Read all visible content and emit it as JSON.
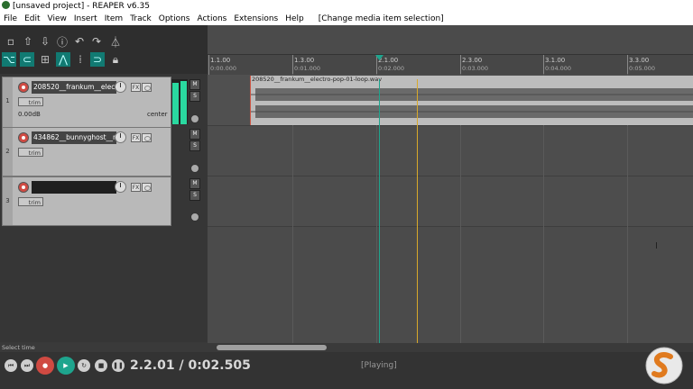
{
  "window": {
    "title": "[unsaved project] - REAPER v6.35"
  },
  "menu": {
    "items": [
      "File",
      "Edit",
      "View",
      "Insert",
      "Item",
      "Track",
      "Options",
      "Actions",
      "Extensions",
      "Help"
    ],
    "message": "[Change media item selection]"
  },
  "tracks": [
    {
      "number": "1",
      "name": "208520__frankum__elec",
      "trim": "trim",
      "volume": "0.00dB",
      "pan": "center"
    },
    {
      "number": "2",
      "name": "434862__bunnyghost__r",
      "trim": "trim"
    },
    {
      "number": "3",
      "name": "",
      "trim": "trim"
    }
  ],
  "track_buttons": {
    "fx": "FX",
    "mute": "M",
    "solo": "S"
  },
  "ruler": [
    {
      "bar": "1.1.00",
      "time": "0:00.000"
    },
    {
      "bar": "1.3.00",
      "time": "0:01.000"
    },
    {
      "bar": "2.1.00",
      "time": "0:02.000"
    },
    {
      "bar": "2.3.00",
      "time": "0:03.000"
    },
    {
      "bar": "3.1.00",
      "time": "0:04.000"
    },
    {
      "bar": "3.3.00",
      "time": "0:05.000"
    }
  ],
  "item": {
    "name": "208520__frankum__electro-pop-01-loop.wav"
  },
  "status": {
    "left": "Select time",
    "state": "[Playing]"
  },
  "transport": {
    "position": "2.2.01 / 0:02.505"
  },
  "colors": {
    "accent": "#117a72",
    "meter": "#2ad9a0",
    "playcursor": "#d8a92a",
    "editcursor": "#1ea58e",
    "record": "#d04a42"
  }
}
